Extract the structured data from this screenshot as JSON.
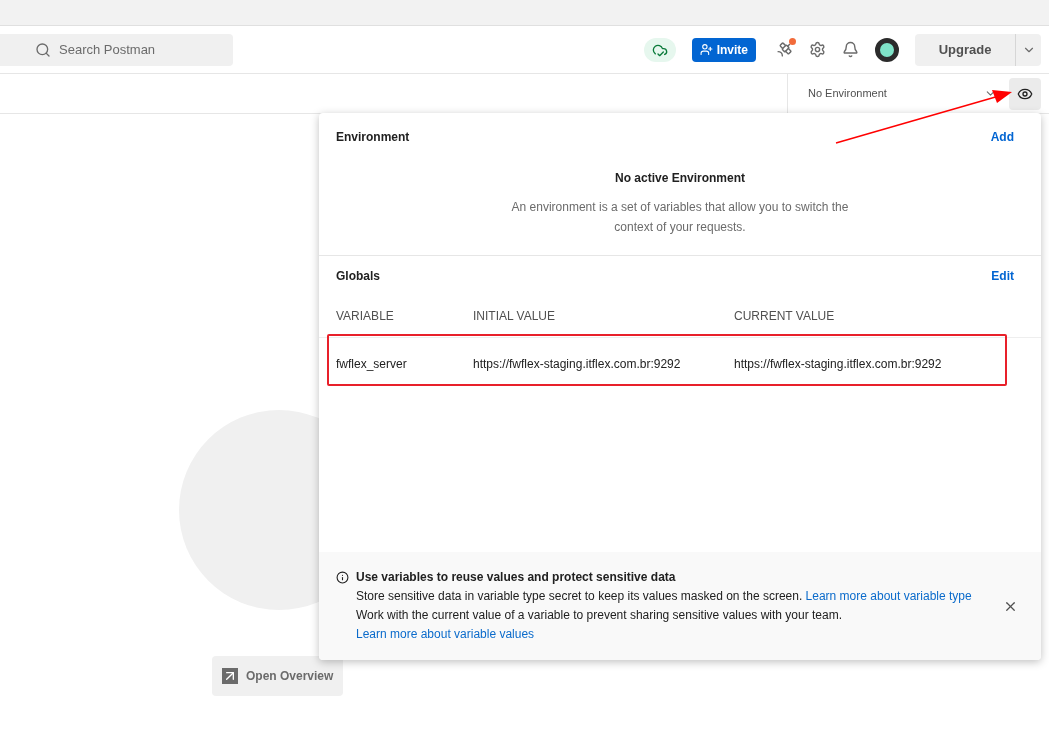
{
  "header": {
    "search": {
      "placeholder": "Search Postman"
    },
    "invite": "Invite",
    "notification_dot": true,
    "upgrade": "Upgrade"
  },
  "environment_selector": {
    "value": "No Environment"
  },
  "popup": {
    "environment": {
      "title": "Environment",
      "action": "Add",
      "empty_title": "No active Environment",
      "empty_text": "An environment is a set of variables that allow you to switch the context of your requests."
    },
    "globals": {
      "title": "Globals",
      "action": "Edit",
      "columns": [
        "VARIABLE",
        "INITIAL VALUE",
        "CURRENT VALUE"
      ],
      "rows": [
        {
          "variable": "fwflex_server",
          "initial": "https://fwflex-staging.itflex.com.br:9292",
          "current": "https://fwflex-staging.itflex.com.br:9292",
          "highlighted": true
        }
      ]
    },
    "notice": {
      "title": "Use variables to reuse values and protect sensitive data",
      "lines": [
        {
          "text": "Store sensitive data in variable type secret to keep its values masked on the screen.",
          "link": "Learn more about variable type"
        },
        {
          "text": "Work with the current value of a variable to prevent sharing sensitive values with your team.",
          "link": "Learn more about variable values"
        }
      ]
    }
  },
  "open_overview": "Open Overview"
}
